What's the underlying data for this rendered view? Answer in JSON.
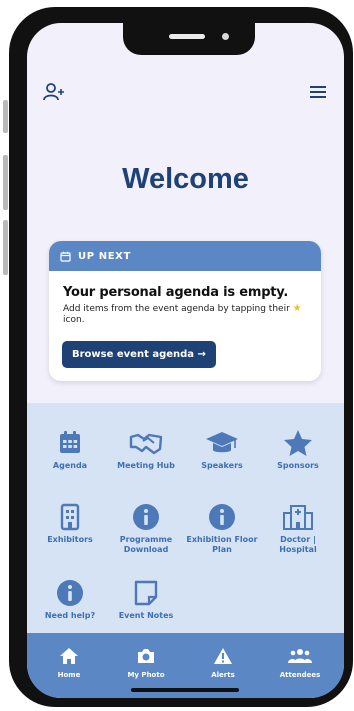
{
  "header": {
    "title": "Welcome"
  },
  "up_next": {
    "heading": "UP NEXT",
    "title": "Your personal agenda is empty.",
    "desc_pre": "Add items from the event agenda by tapping their",
    "desc_post": "icon.",
    "browse_label": "Browse event agenda →"
  },
  "tiles": [
    {
      "label": "Agenda",
      "icon": "calendar-icon"
    },
    {
      "label": "Meeting Hub",
      "icon": "handshake-icon"
    },
    {
      "label": "Speakers",
      "icon": "graduation-cap-icon"
    },
    {
      "label": "Sponsors",
      "icon": "star-icon"
    },
    {
      "label": "Exhibitors",
      "icon": "building-icon"
    },
    {
      "label": "Programme Download",
      "icon": "info-icon"
    },
    {
      "label": "Exhibition Floor Plan",
      "icon": "info-icon"
    },
    {
      "label": "Doctor | Hospital",
      "icon": "hospital-icon"
    },
    {
      "label": "Need help?",
      "icon": "info-icon"
    },
    {
      "label": "Event Notes",
      "icon": "note-icon"
    }
  ],
  "tabs": [
    {
      "label": "Home",
      "icon": "home-icon",
      "active": true
    },
    {
      "label": "My Photo",
      "icon": "camera-icon",
      "active": false
    },
    {
      "label": "Alerts",
      "icon": "alert-icon",
      "active": false
    },
    {
      "label": "Attendees",
      "icon": "people-icon",
      "active": false
    }
  ],
  "colors": {
    "accent": "#5b88c4",
    "dark_blue": "#1f4276",
    "panel_bg": "#d6e3f4",
    "screen_bg": "#f2f0fa"
  }
}
